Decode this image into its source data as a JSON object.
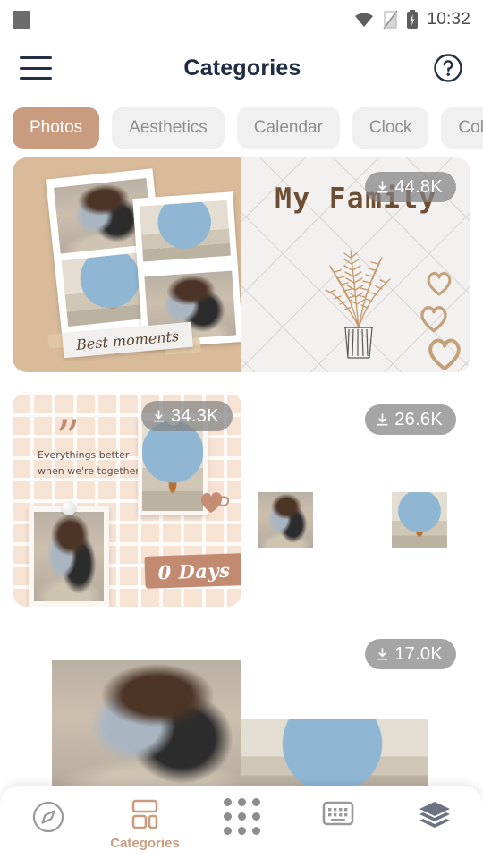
{
  "statusbar": {
    "time": "10:32",
    "icons": [
      "app-square-icon",
      "wifi-icon",
      "sim-off-icon",
      "battery-charging-icon"
    ]
  },
  "header": {
    "title": "Categories",
    "menu_icon": "hamburger-icon",
    "help_icon": "help-circle-icon"
  },
  "chips": [
    {
      "label": "Photos",
      "active": true
    },
    {
      "label": "Aesthetics",
      "active": false
    },
    {
      "label": "Calendar",
      "active": false
    },
    {
      "label": "Clock",
      "active": false
    },
    {
      "label": "Colors",
      "active": false
    }
  ],
  "cards": [
    {
      "id": "my-family",
      "downloads": "44.8K",
      "left_title": "Best moments",
      "right_title": "My Family",
      "decor": [
        "fern-plant-illustration",
        "heart-outline",
        "heart-outline",
        "heart-outline"
      ]
    },
    {
      "id": "together",
      "downloads_left": "34.3K",
      "downloads_right": "26.6K",
      "quote_line1": "Everythings better",
      "quote_line2": "when we're together.",
      "banner": "0 Days"
    },
    {
      "id": "third-row",
      "downloads": "17.0K"
    }
  ],
  "bottomnav": {
    "items": [
      {
        "icon": "compass-icon",
        "label": "",
        "active": false
      },
      {
        "icon": "categories-grid-icon",
        "label": "Categories",
        "active": true
      },
      {
        "icon": "apps-dots-icon",
        "label": "",
        "active": false
      },
      {
        "icon": "keyboard-icon",
        "label": "",
        "active": false
      },
      {
        "icon": "layers-icon",
        "label": "",
        "active": false
      }
    ]
  },
  "colors": {
    "accent": "#c99c80",
    "title": "#202c44",
    "chip_bg": "#f0f0f0",
    "badge_bg": "rgba(130,130,130,.72)"
  }
}
